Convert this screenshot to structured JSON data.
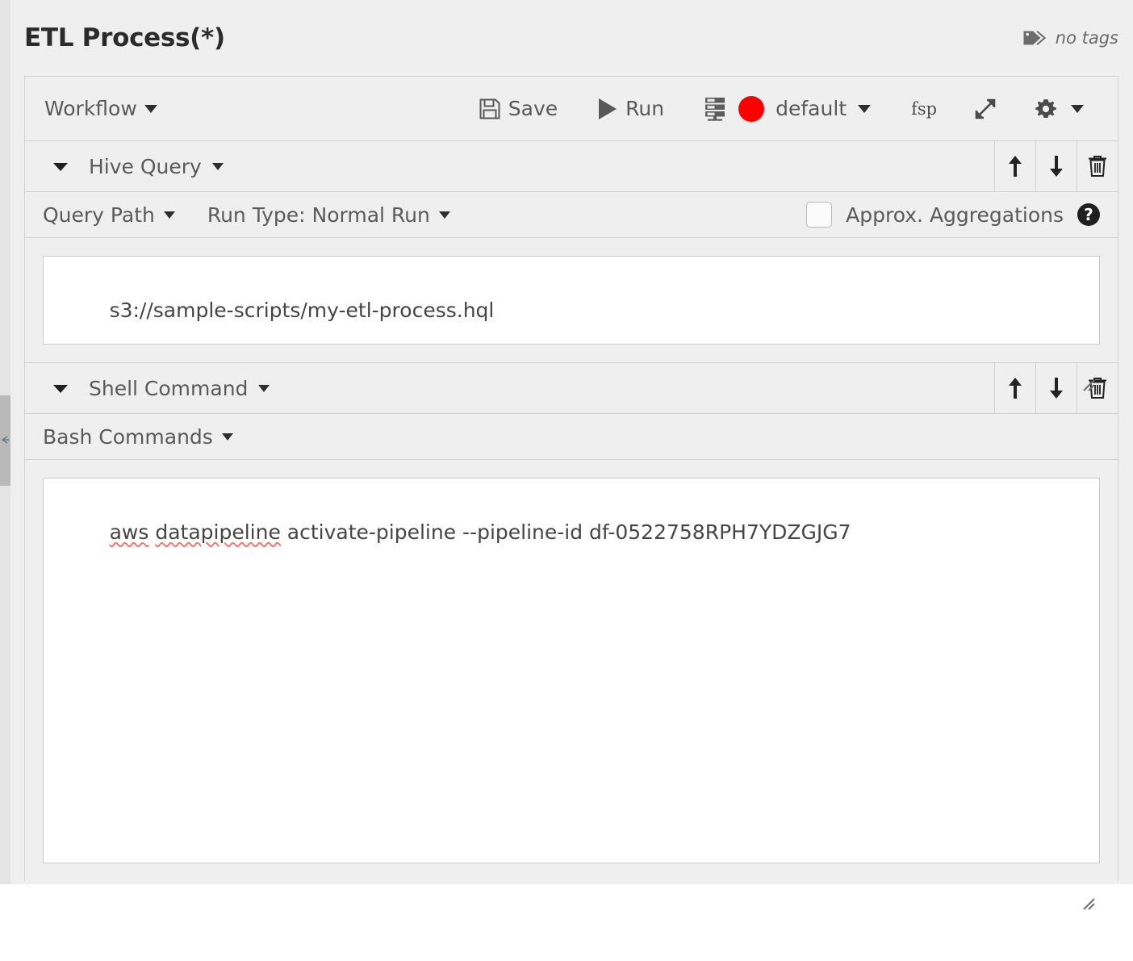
{
  "header": {
    "title": "ETL Process(*)",
    "tags_label": "no tags",
    "tags_icon": "tags-icon"
  },
  "toolbar": {
    "workflow_label": "Workflow",
    "save_label": "Save",
    "save_icon": "floppy-disk-icon",
    "run_label": "Run",
    "run_icon": "play-triangle-icon",
    "cluster_icon": "server-stack-icon",
    "cluster_status_color": "#fc0000",
    "cluster_label": "default",
    "fsp_label": "fsp",
    "expand_icon": "expand-diagonal-icon",
    "settings_icon": "gear-icon",
    "dropdown_icon": "chevron-down-icon"
  },
  "steps": [
    {
      "name": "Hive Query",
      "collapse_icon": "triangle-down-icon",
      "actions": {
        "move_up_icon": "arrow-up-icon",
        "move_down_icon": "arrow-down-icon",
        "delete_icon": "trash-icon"
      },
      "options": {
        "source_label": "Query Path",
        "run_type_label": "Run Type: Normal Run",
        "approx_label": "Approx. Aggregations",
        "approx_checked": false,
        "help_icon": "question-mark-icon",
        "help_glyph": "?"
      },
      "editor": {
        "value": "s3://sample-scripts/my-etl-process.hql",
        "resize_icon": "resize-grip-icon"
      }
    },
    {
      "name": "Shell Command",
      "collapse_icon": "triangle-down-icon",
      "actions": {
        "move_up_icon": "arrow-up-icon",
        "move_down_icon": "arrow-down-icon",
        "delete_icon": "trash-icon"
      },
      "options": {
        "source_label": "Bash Commands"
      },
      "editor": {
        "value_misspelled_1": "aws",
        "value_misspelled_2": "datapipeline",
        "value_rest": " activate-pipeline --pipeline-id df-0522758RPH7YDZGJG7",
        "resize_icon": "resize-grip-icon"
      }
    }
  ],
  "scrollbar": {
    "name": "vertical-scrollbar",
    "grip_glyph": "⇤"
  }
}
